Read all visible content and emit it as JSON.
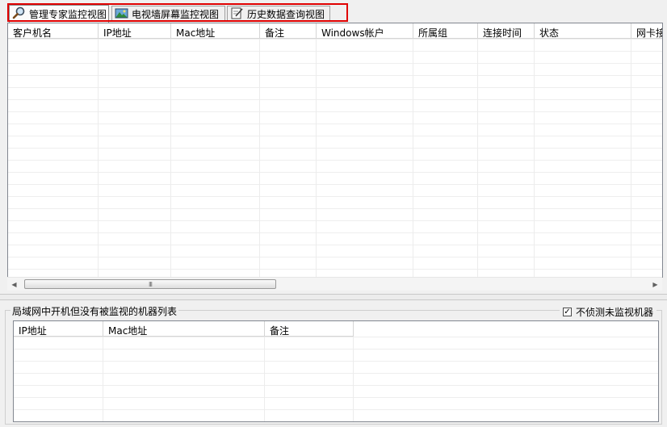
{
  "tabs": [
    {
      "label": "管理专家监控视图",
      "icon": "magnifier-icon"
    },
    {
      "label": "电视墙屏幕监控视图",
      "icon": "picture-icon"
    },
    {
      "label": "历史数据查询视图",
      "icon": "edit-document-icon"
    }
  ],
  "clients_table": {
    "columns": [
      "客户机名",
      "IP地址",
      "Mac地址",
      "备注",
      "Windows帐户",
      "所属组",
      "连接时间",
      "状态",
      "网卡接"
    ]
  },
  "unmonitored_panel": {
    "title": "局域网中开机但没有被监视的机器列表",
    "checkbox_label": "不侦测未监视机器",
    "checkbox_checked": true,
    "columns": [
      "IP地址",
      "Mac地址",
      "备注"
    ]
  },
  "scrollbar": {
    "grip": "III"
  },
  "icons": {
    "scroll_left": "◀",
    "scroll_right": "▶",
    "check": "✓"
  }
}
